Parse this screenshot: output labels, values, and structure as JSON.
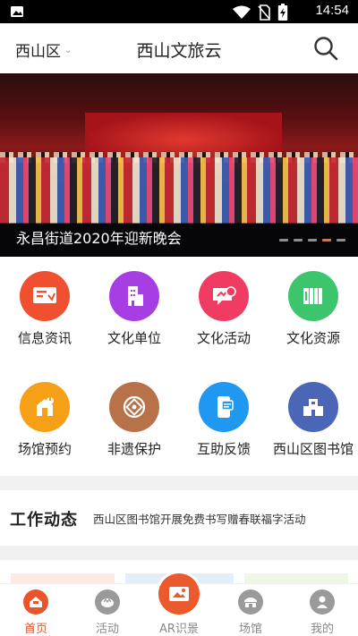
{
  "status_bar": {
    "time": "14:54",
    "icons": [
      "image-icon",
      "wifi-icon",
      "no-sim-icon",
      "battery-charging-icon"
    ]
  },
  "header": {
    "region": "西山区",
    "title": "西山文旅云",
    "search_icon": "search-icon"
  },
  "banner": {
    "caption": "永昌街道2020年迎新晚会",
    "total_slides": 5,
    "active_slide": 4
  },
  "grid": {
    "items": [
      {
        "label": "信息资讯",
        "icon": "news-icon",
        "color": "#f0502f"
      },
      {
        "label": "文化单位",
        "icon": "building-icon",
        "color": "#a73ee3"
      },
      {
        "label": "文化活动",
        "icon": "activity-icon",
        "color": "#f03c63"
      },
      {
        "label": "文化资源",
        "icon": "resource-icon",
        "color": "#3cc56c"
      },
      {
        "label": "场馆预约",
        "icon": "venue-icon",
        "color": "#f5a016"
      },
      {
        "label": "非遗保护",
        "icon": "heritage-icon",
        "color": "#b8724a"
      },
      {
        "label": "互助反馈",
        "icon": "feedback-icon",
        "color": "#1f98f2"
      },
      {
        "label": "西山区图书馆",
        "icon": "library-icon",
        "color": "#4b66b6"
      }
    ]
  },
  "news": {
    "title": "工作动态",
    "headline": "西山区图书馆开展免费书写赠春联福字活动"
  },
  "bottom_nav": {
    "items": [
      {
        "label": "首页",
        "icon": "home-icon",
        "active": true
      },
      {
        "label": "活动",
        "icon": "activity-nav-icon",
        "active": false
      },
      {
        "label": "AR识景",
        "icon": "ar-scan-icon",
        "active": false
      },
      {
        "label": "场馆",
        "icon": "venue-nav-icon",
        "active": false
      },
      {
        "label": "我的",
        "icon": "profile-icon",
        "active": false
      }
    ],
    "accent": "#e8552b"
  }
}
